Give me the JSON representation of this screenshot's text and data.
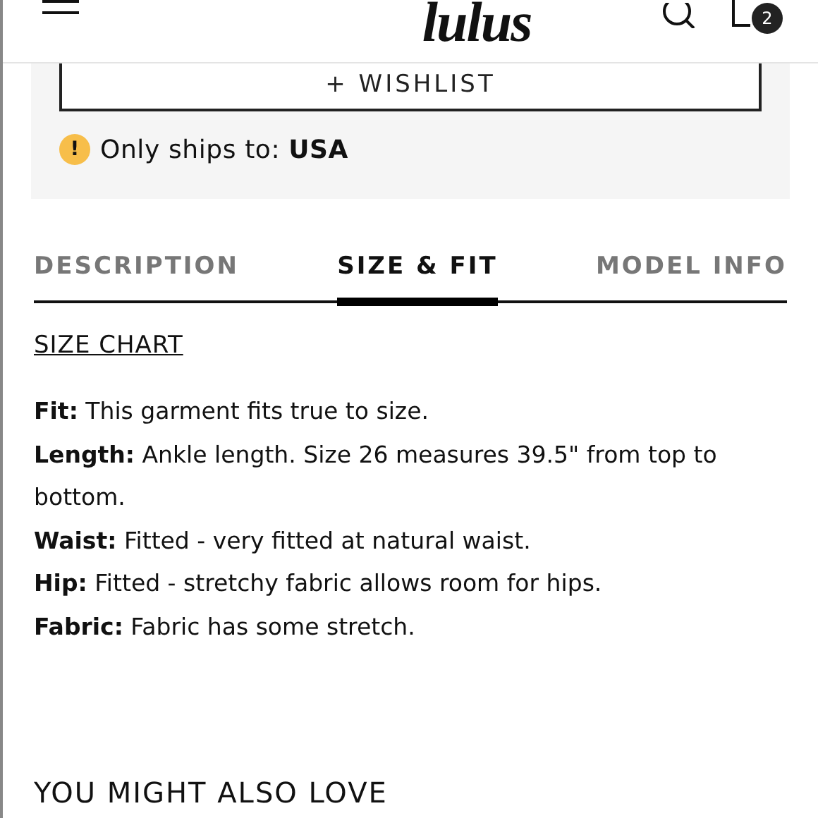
{
  "header": {
    "logo": "lulus",
    "cart_count": "2"
  },
  "wishlist_button": {
    "label": "+ WISHLIST"
  },
  "shipping_notice": {
    "icon": "!",
    "text": "Only ships to: **USA**"
  },
  "tabs": [
    {
      "label": "DESCRIPTION",
      "selected": false
    },
    {
      "label": "SIZE & FIT",
      "selected": true
    },
    {
      "label": "MODEL INFO",
      "selected": false
    }
  ],
  "size_chart_link": "SIZE CHART",
  "details": [
    {
      "label": "Fit:",
      "text": "This garment fits true to size."
    },
    {
      "label": "Length:",
      "text": "Ankle length. Size 26 measures 39.5\" from top to bottom."
    },
    {
      "label": "Waist:",
      "text": "Fitted - very fitted at natural waist."
    },
    {
      "label": "Hip:",
      "text": "Fitted - stretchy fabric allows room for hips."
    },
    {
      "label": "Fabric:",
      "text": "Fabric has some stretch."
    }
  ],
  "section_heading": "YOU MIGHT ALSO LOVE"
}
